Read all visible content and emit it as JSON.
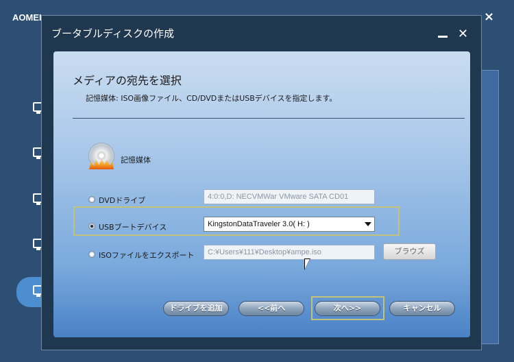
{
  "app": {
    "title": "AOMEI",
    "close": "×"
  },
  "dialog": {
    "title": "ブータブルディスクの作成",
    "minimize": "–",
    "close": "✕",
    "heading": "メディアの宛先を選択",
    "description": "記憶媒体: ISO画像ファイル、CD/DVDまたはUSBデバイスを指定します。",
    "media_label": "記憶媒体",
    "options": {
      "dvd": {
        "label": "DVDドライブ",
        "value": "4:0:0,D: NECVMWar VMware SATA CD01",
        "checked": false
      },
      "usb": {
        "label": "USBブートデバイス",
        "value": "KingstonDataTraveler 3.0( H: )",
        "checked": true
      },
      "iso": {
        "label": "ISOファイルをエクスポート",
        "value": "C:¥Users¥111¥Desktop¥ampe.iso",
        "checked": false,
        "browse": "ブラウズ"
      }
    },
    "buttons": {
      "add_drive": "ドライブを追加",
      "back": "<<前へ",
      "next": "次へ>>",
      "cancel": "キャンセル"
    }
  },
  "colors": {
    "accent_highlight": "#c2c27a",
    "panel_top": "#c9dcf0",
    "panel_bottom": "#4a82c7"
  }
}
